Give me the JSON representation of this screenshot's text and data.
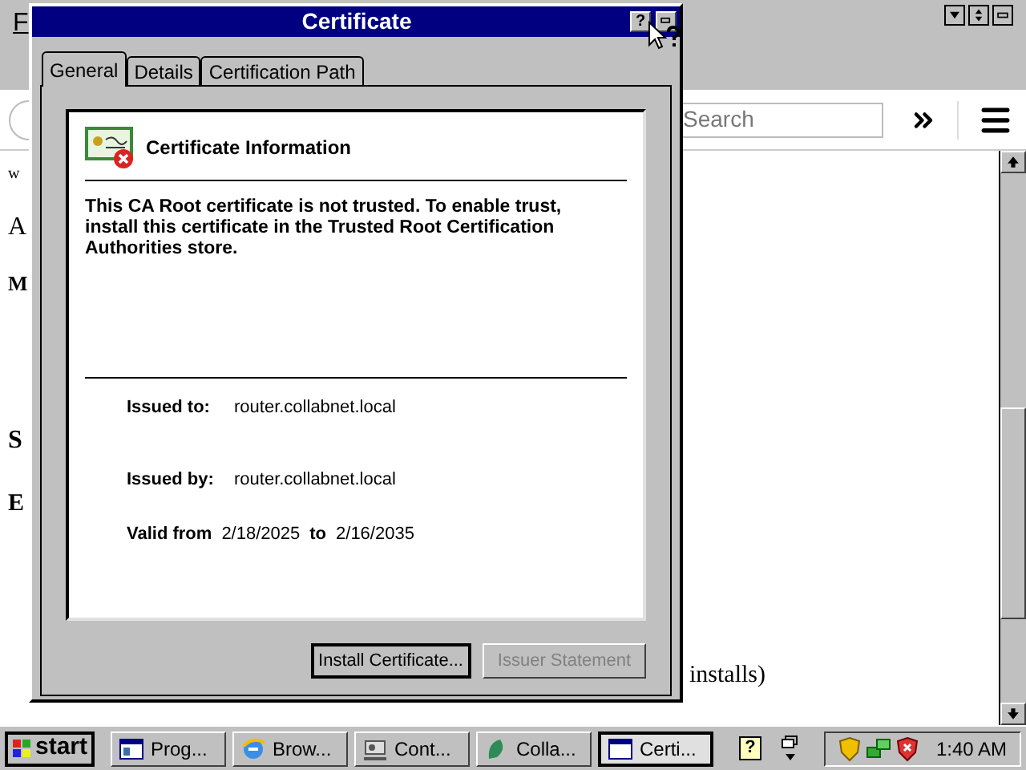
{
  "browser": {
    "menu": [
      "F"
    ],
    "search": {
      "placeholder": "Search"
    },
    "page_fragments": [
      "w",
      "A",
      "M",
      "S",
      "E"
    ],
    "page_text": "installs)"
  },
  "dialog": {
    "title": "Certificate",
    "help_button": "?",
    "tabs": [
      {
        "label": "General",
        "selected": true
      },
      {
        "label": "Details",
        "selected": false
      },
      {
        "label": "Certification Path",
        "selected": false
      }
    ],
    "heading": "Certificate Information",
    "message": "This CA Root certificate is not trusted. To enable trust, install this certificate in the Trusted Root Certification Authorities store.",
    "fields": [
      {
        "label": "Issued to:",
        "value": "router.collabnet.local"
      },
      {
        "label": "Issued by:",
        "value": "router.collabnet.local"
      }
    ],
    "validity": {
      "label": "Valid from",
      "from": "2/18/2025",
      "separator": "to",
      "to": "2/16/2035"
    },
    "buttons": [
      {
        "label": "Install Certificate...",
        "default": true,
        "disabled": false
      },
      {
        "label": "Issuer Statement",
        "default": false,
        "disabled": true
      }
    ]
  },
  "taskbar": {
    "start": "start",
    "tasks": [
      {
        "label": "Prog...",
        "kind": "programs",
        "selected": false
      },
      {
        "label": "Brow...",
        "kind": "browser",
        "selected": false
      },
      {
        "label": "Cont...",
        "kind": "control",
        "selected": false
      },
      {
        "label": "Colla...",
        "kind": "collab",
        "selected": false
      },
      {
        "label": "Certi...",
        "kind": "window",
        "selected": true
      }
    ],
    "help": "?",
    "clock": "1:40 AM"
  }
}
